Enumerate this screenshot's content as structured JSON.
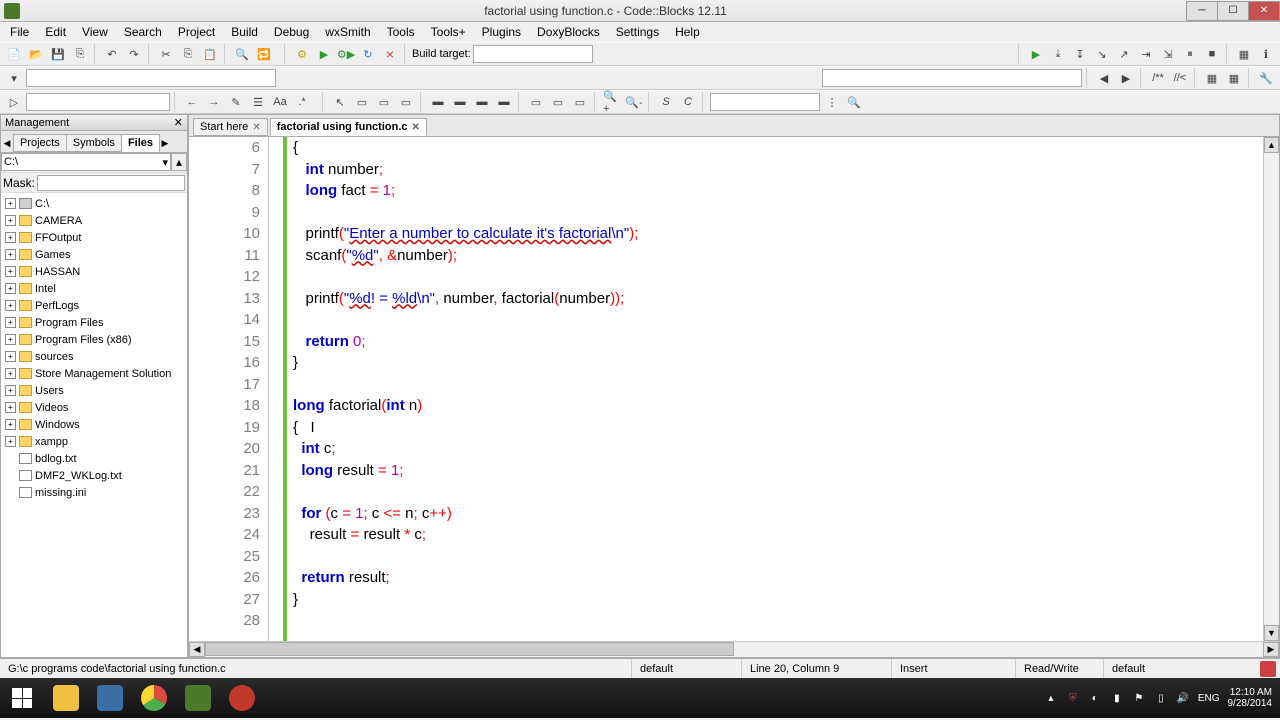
{
  "window": {
    "title": "factorial using function.c - Code::Blocks 12.11"
  },
  "menu": [
    "File",
    "Edit",
    "View",
    "Search",
    "Project",
    "Build",
    "Debug",
    "wxSmith",
    "Tools",
    "Tools+",
    "Plugins",
    "DoxyBlocks",
    "Settings",
    "Help"
  ],
  "toolbar2": {
    "build_target_label": "Build target:"
  },
  "management": {
    "title": "Management",
    "tabs": [
      "Projects",
      "Symbols",
      "Files"
    ],
    "active_tab": "Files",
    "path_value": "C:\\",
    "mask_label": "Mask:",
    "tree": [
      {
        "type": "drive",
        "label": "C:\\"
      },
      {
        "type": "folder",
        "label": "CAMERA"
      },
      {
        "type": "folder",
        "label": "FFOutput"
      },
      {
        "type": "folder",
        "label": "Games"
      },
      {
        "type": "folder",
        "label": "HASSAN"
      },
      {
        "type": "folder",
        "label": "Intel"
      },
      {
        "type": "folder",
        "label": "PerfLogs"
      },
      {
        "type": "folder",
        "label": "Program Files"
      },
      {
        "type": "folder",
        "label": "Program Files (x86)"
      },
      {
        "type": "folder",
        "label": "sources"
      },
      {
        "type": "folder",
        "label": "Store Management Solution"
      },
      {
        "type": "folder",
        "label": "Users"
      },
      {
        "type": "folder",
        "label": "Videos"
      },
      {
        "type": "folder",
        "label": "Windows"
      },
      {
        "type": "folder",
        "label": "xampp"
      },
      {
        "type": "file",
        "label": "bdlog.txt"
      },
      {
        "type": "file",
        "label": "DMF2_WKLog.txt"
      },
      {
        "type": "file",
        "label": "missing.ini"
      }
    ]
  },
  "doctabs": [
    {
      "label": "Start here",
      "active": false
    },
    {
      "label": "factorial using function.c",
      "active": true
    }
  ],
  "code": {
    "first_line": 6,
    "lines": [
      [
        {
          "t": "{",
          "c": ""
        }
      ],
      [
        {
          "t": "   "
        },
        {
          "t": "int",
          "c": "kw"
        },
        {
          "t": " number"
        },
        {
          "t": ";",
          "c": "op"
        }
      ],
      [
        {
          "t": "   "
        },
        {
          "t": "long",
          "c": "kw"
        },
        {
          "t": " fact "
        },
        {
          "t": "=",
          "c": "op"
        },
        {
          "t": " "
        },
        {
          "t": "1",
          "c": "num"
        },
        {
          "t": ";",
          "c": "op"
        }
      ],
      [],
      [
        {
          "t": "   printf"
        },
        {
          "t": "(",
          "c": "op"
        },
        {
          "t": "\"",
          "c": "str"
        },
        {
          "t": "Enter a number to calculate it's factorial",
          "c": "str underl"
        },
        {
          "t": "\\n\"",
          "c": "str"
        },
        {
          "t": ");",
          "c": "op"
        }
      ],
      [
        {
          "t": "   scanf"
        },
        {
          "t": "(",
          "c": "op"
        },
        {
          "t": "\"",
          "c": "str"
        },
        {
          "t": "%d",
          "c": "str underl"
        },
        {
          "t": "\"",
          "c": "str"
        },
        {
          "t": ",",
          "c": "op"
        },
        {
          "t": " "
        },
        {
          "t": "&",
          "c": "op"
        },
        {
          "t": "number"
        },
        {
          "t": ");",
          "c": "op"
        }
      ],
      [],
      [
        {
          "t": "   printf"
        },
        {
          "t": "(",
          "c": "op"
        },
        {
          "t": "\"",
          "c": "str"
        },
        {
          "t": "%d",
          "c": "str underl"
        },
        {
          "t": "! = ",
          "c": "str"
        },
        {
          "t": "%ld",
          "c": "str underl"
        },
        {
          "t": "\\n\"",
          "c": "str"
        },
        {
          "t": ",",
          "c": "op"
        },
        {
          "t": " number"
        },
        {
          "t": ",",
          "c": "op"
        },
        {
          "t": " factorial"
        },
        {
          "t": "(",
          "c": "op"
        },
        {
          "t": "number"
        },
        {
          "t": "));",
          "c": "op"
        }
      ],
      [],
      [
        {
          "t": "   "
        },
        {
          "t": "return",
          "c": "kw"
        },
        {
          "t": " "
        },
        {
          "t": "0",
          "c": "num"
        },
        {
          "t": ";",
          "c": "op"
        }
      ],
      [
        {
          "t": "}",
          "c": ""
        }
      ],
      [],
      [
        {
          "t": "long",
          "c": "kw"
        },
        {
          "t": " factorial"
        },
        {
          "t": "(",
          "c": "op"
        },
        {
          "t": "int",
          "c": "kw"
        },
        {
          "t": " n"
        },
        {
          "t": ")",
          "c": "op"
        }
      ],
      [
        {
          "t": "{   I",
          "c": ""
        }
      ],
      [
        {
          "t": "  "
        },
        {
          "t": "int",
          "c": "kw"
        },
        {
          "t": " c"
        },
        {
          "t": ";",
          "c": "op"
        }
      ],
      [
        {
          "t": "  "
        },
        {
          "t": "long",
          "c": "kw"
        },
        {
          "t": " result "
        },
        {
          "t": "=",
          "c": "op"
        },
        {
          "t": " "
        },
        {
          "t": "1",
          "c": "num"
        },
        {
          "t": ";",
          "c": "op"
        }
      ],
      [],
      [
        {
          "t": "  "
        },
        {
          "t": "for",
          "c": "kw"
        },
        {
          "t": " "
        },
        {
          "t": "(",
          "c": "op"
        },
        {
          "t": "c "
        },
        {
          "t": "=",
          "c": "op"
        },
        {
          "t": " "
        },
        {
          "t": "1",
          "c": "num"
        },
        {
          "t": ";",
          "c": "op"
        },
        {
          "t": " c "
        },
        {
          "t": "<=",
          "c": "op"
        },
        {
          "t": " n"
        },
        {
          "t": ";",
          "c": "op"
        },
        {
          "t": " c"
        },
        {
          "t": "++)",
          "c": "op"
        }
      ],
      [
        {
          "t": "    result "
        },
        {
          "t": "=",
          "c": "op"
        },
        {
          "t": " result "
        },
        {
          "t": "*",
          "c": "op"
        },
        {
          "t": " c"
        },
        {
          "t": ";",
          "c": "op"
        }
      ],
      [],
      [
        {
          "t": "  "
        },
        {
          "t": "return",
          "c": "kw"
        },
        {
          "t": " result"
        },
        {
          "t": ";",
          "c": "op"
        }
      ],
      [
        {
          "t": "}",
          "c": ""
        }
      ],
      []
    ]
  },
  "statusbar": {
    "path": "G:\\c programs code\\factorial using function.c",
    "enc": "default",
    "pos": "Line 20, Column 9",
    "ins": "Insert",
    "rw": "Read/Write",
    "lang": "default"
  },
  "taskbar": {
    "lang_code": "ENG",
    "time": "12:10 AM",
    "date": "9/28/2014"
  }
}
